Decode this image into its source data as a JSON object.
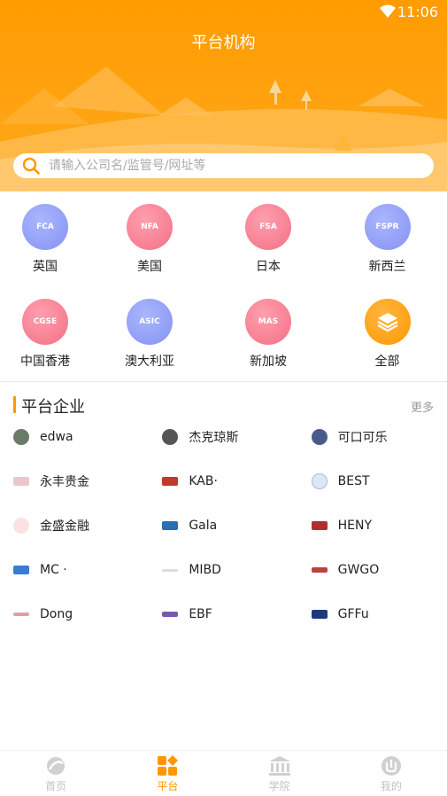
{
  "status_bar": {
    "time": "11:06"
  },
  "header": {
    "title": "平台机构"
  },
  "search": {
    "placeholder": "请输入公司名/监管号/网址等"
  },
  "regulators": [
    {
      "abbr": "FCA",
      "label": "英国",
      "color": "blue"
    },
    {
      "abbr": "NFA",
      "label": "美国",
      "color": "pink"
    },
    {
      "abbr": "FSA",
      "label": "日本",
      "color": "pink"
    },
    {
      "abbr": "FSPR",
      "label": "新西兰",
      "color": "blue"
    },
    {
      "abbr": "CGSE",
      "label": "中国香港",
      "color": "pink"
    },
    {
      "abbr": "ASIC",
      "label": "澳大利亚",
      "color": "blue"
    },
    {
      "abbr": "MAS",
      "label": "新加坡",
      "color": "pink"
    },
    {
      "abbr": "",
      "label": "全部",
      "color": "orange",
      "icon": "layers-icon"
    }
  ],
  "enterprises": {
    "title": "平台企业",
    "more": "更多",
    "items": [
      {
        "name": "edwa",
        "logo_color": "#6b7a68"
      },
      {
        "name": "杰克琼斯",
        "logo_color": "#555555"
      },
      {
        "name": "可口可乐",
        "logo_color": "#4a5a8a"
      },
      {
        "name": "永丰贵金",
        "logo_color": "#e8c8c8"
      },
      {
        "name": "KAB·",
        "logo_color": "#c0392b"
      },
      {
        "name": "BEST",
        "logo_color": "#a8b8e8"
      },
      {
        "name": "金盛金融",
        "logo_color": "#f3c2c2"
      },
      {
        "name": "Gala",
        "logo_color": "#2a6fb0"
      },
      {
        "name": "HENY",
        "logo_color": "#b03030"
      },
      {
        "name": "MC ·",
        "logo_color": "#3a7bd5"
      },
      {
        "name": "MIBD",
        "logo_color": "#cccccc"
      },
      {
        "name": "GWGO",
        "logo_color": "#c04040"
      },
      {
        "name": "Dong",
        "logo_color": "#e0a0a0"
      },
      {
        "name": "EBF",
        "logo_color": "#7a5ab0"
      },
      {
        "name": "GFFu",
        "logo_color": "#1a3a7a"
      }
    ]
  },
  "bottom_nav": [
    {
      "label": "首页",
      "icon": "home-icon",
      "active": false
    },
    {
      "label": "平台",
      "icon": "platform-icon",
      "active": true
    },
    {
      "label": "学院",
      "icon": "academy-icon",
      "active": false
    },
    {
      "label": "我的",
      "icon": "profile-icon",
      "active": false
    }
  ],
  "colors": {
    "accent": "#ff9800",
    "inactive": "#c2c2c2"
  }
}
